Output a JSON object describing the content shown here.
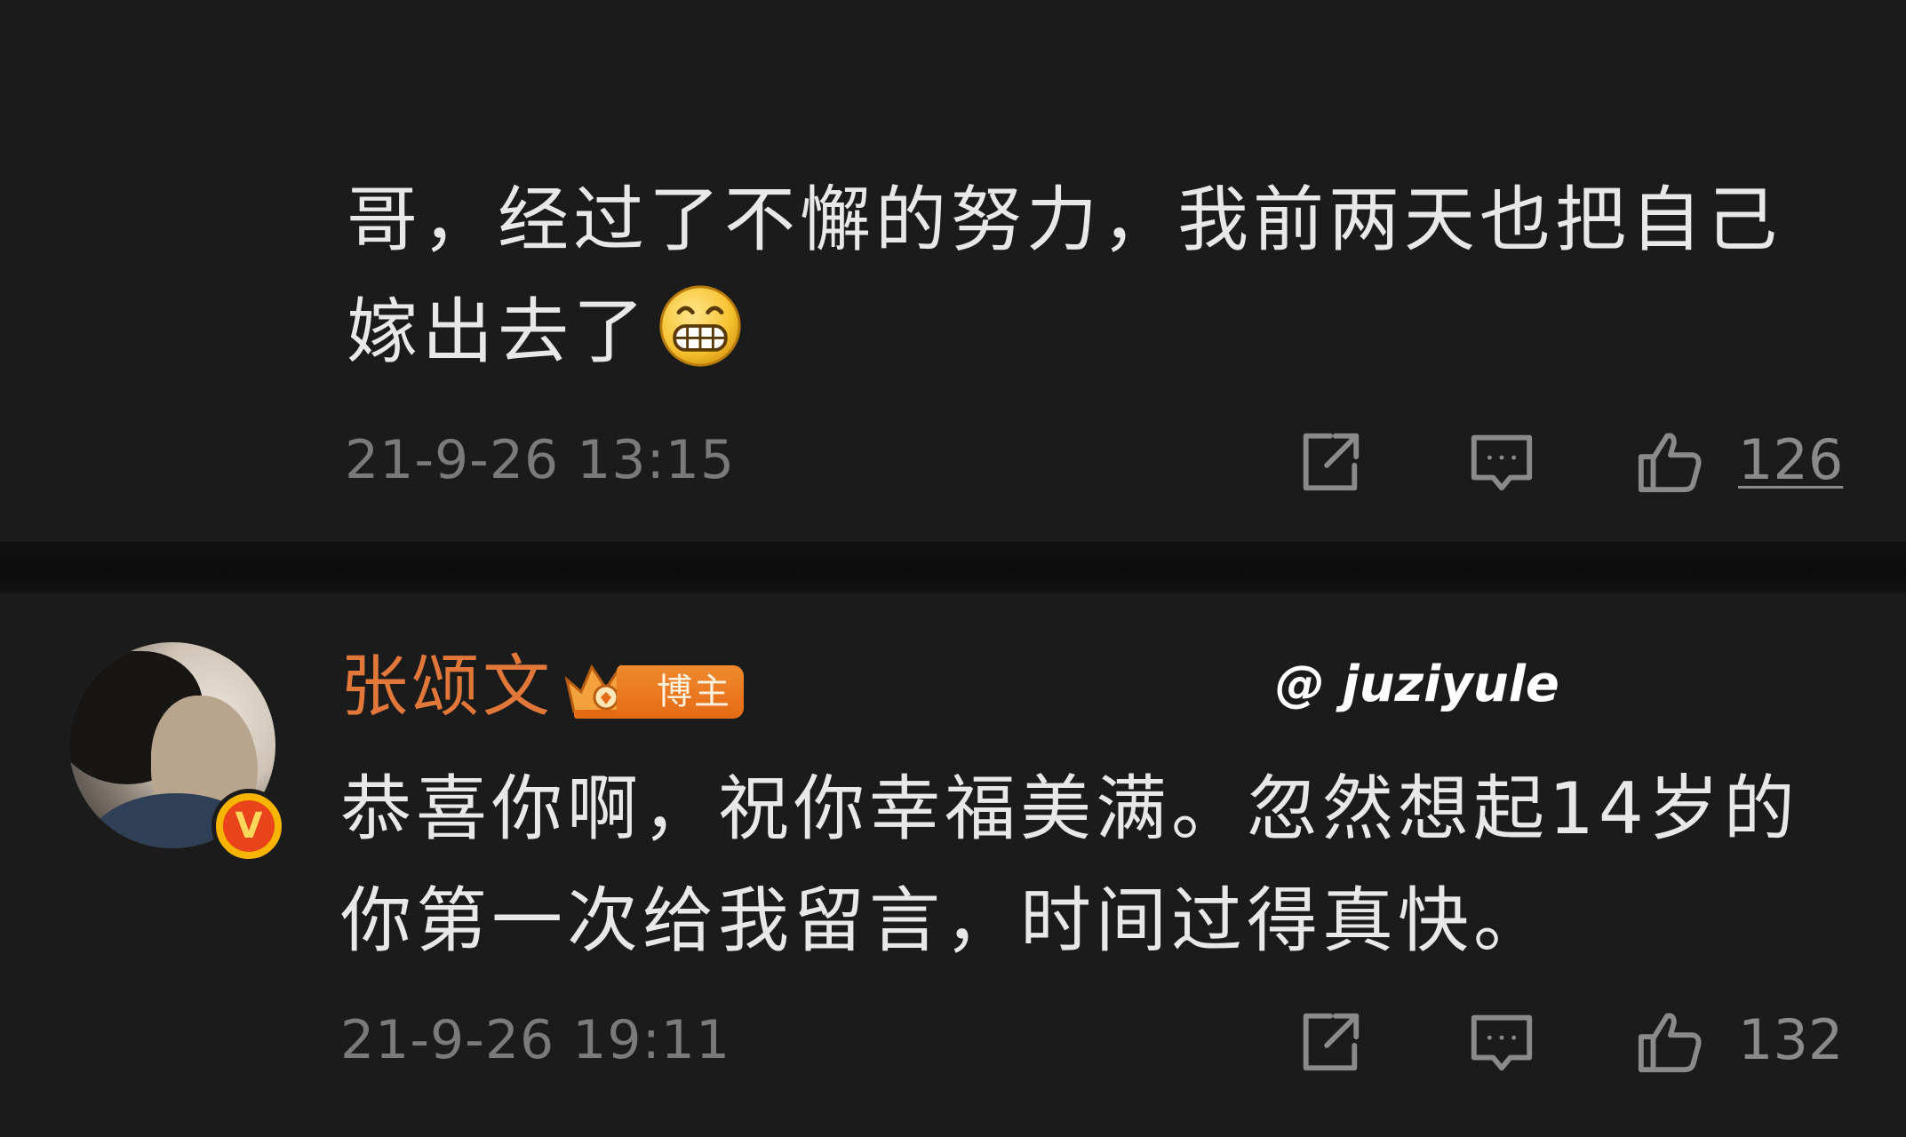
{
  "comments": [
    {
      "text": "哥，经过了不懈的努力，我前两天也把自己嫁出去了",
      "emoji_icon": "grinning-face-icon",
      "timestamp": "21-9-26 13:15",
      "like_count": "126"
    },
    {
      "username": "张颂文",
      "author_badge_label": "博主",
      "verified_badge_icon": "v-verified-icon",
      "text": "恭喜你啊，祝你幸福美满。忽然想起14岁的你第一次给我留言，时间过得真快。",
      "timestamp": "21-9-26 19:11",
      "like_count": "132"
    }
  ],
  "watermark": "@ juziyule",
  "colors": {
    "background": "#1b1b1b",
    "text": "#e8e8e8",
    "meta": "#7a7a7a",
    "username": "#e2773a",
    "badge": "#e56a15"
  }
}
